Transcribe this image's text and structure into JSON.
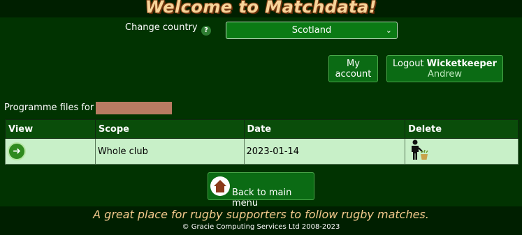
{
  "header": {
    "title": "Welcome to Matchdata!"
  },
  "country": {
    "label": "Change country",
    "help": "?",
    "selected": "Scotland"
  },
  "account": {
    "my_account_line1": "My",
    "my_account_line2": "account",
    "logout_prefix": "Logout",
    "username": "Wicketkeeper",
    "user_first_name": "Andrew"
  },
  "programme": {
    "label": "Programme files for"
  },
  "table": {
    "headers": [
      "View",
      "Scope",
      "Date",
      "Delete"
    ],
    "rows": [
      {
        "scope": "Whole club",
        "date": "2023-01-14"
      }
    ]
  },
  "back": {
    "label": "Back to main menu"
  },
  "footer": {
    "tagline": "A great place for rugby supporters to follow rugby matches.",
    "copyright": "© Gracie Computing Services Ltd 2008-2023"
  },
  "colors": {
    "page_bg": "#013301",
    "header_bg": "#0a4d0a",
    "row_bg": "#c8f0c8",
    "title": "#f7d49a",
    "tagline": "#f2c98c",
    "redaction": "#b87b62"
  },
  "icons": {
    "help": "help-icon",
    "view": "arrow-right-icon",
    "delete": "person-trash-icon",
    "home": "home-icon",
    "dropdown": "chevron-down-icon"
  }
}
